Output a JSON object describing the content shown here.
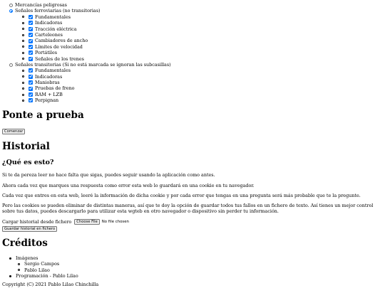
{
  "categories": [
    {
      "label": "Mercancías peligrosas",
      "selected": false,
      "items": []
    },
    {
      "label": "Señales ferroviarias (no transitorias)",
      "selected": true,
      "items": [
        "Fundamentales",
        "Indicadoras",
        "Tracción eléctrica",
        "Carteleones",
        "Cambiadores de ancho",
        "Límites de velocidad",
        "Portátiles",
        "Señales de los trenes"
      ]
    },
    {
      "label": "Señales transitorias (Si no está marcada se ignoran las subcasillas)",
      "selected": false,
      "items": [
        "Fundamentales",
        "Indicadoras",
        "Maniobras",
        "Pruebas de freno",
        "RAM + LZB",
        "Perpignan"
      ]
    }
  ],
  "quiz": {
    "title": "Ponte a prueba",
    "start_button": "Comenzar"
  },
  "history": {
    "title": "Historial",
    "subtitle": "¿Qué es esto?",
    "p1": "Si te da pereza leer no hace falta que sigas, puedes seguir usando la aplicación como antes.",
    "p2": "Ahora cada vez que marques una respuesta como error esta web lo guardará en una cookie en tu navegador.",
    "p3": "Cada vez que entres en esta web, leeré la información de dicha cookie y por cada error que tengas en una pregunta será más probable que te la pregunte.",
    "p4": "Pero las cookies se pueden eliminar de distintas maneras, así que te doy la opción de guardar todos tus fallos en un fichero de texto. Así tienes un mejor control sobre tus datos, puedes descargarlo para utilizar esta wgteb en otro navegador o dispositivo sin perder tu información.",
    "load_label": "Cargar historial desde fichero",
    "choose_file": "Choose File",
    "no_file": "No file chosen",
    "save_button": "Guardar historial en fichero"
  },
  "credits": {
    "title": "Créditos",
    "images_label": "Imágenes",
    "images": [
      "Sergio Campos",
      "Pablo Lilao"
    ],
    "programming": "Programación - Pablo Lilao",
    "copyright": "Copyright (C) 2021 Pablo Lilao Chinchilla"
  }
}
